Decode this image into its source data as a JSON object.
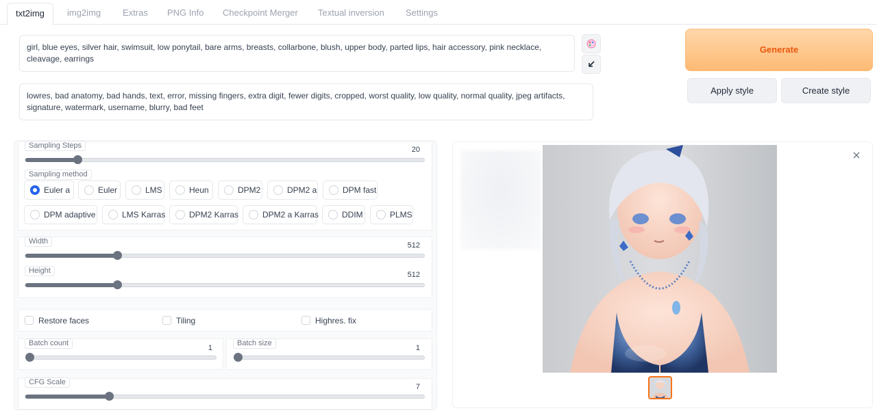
{
  "tabs": [
    "txt2img",
    "img2img",
    "Extras",
    "PNG Info",
    "Checkpoint Merger",
    "Textual inversion",
    "Settings"
  ],
  "prompt": "girl, blue eyes, silver hair, swimsuit, low ponytail, bare arms, breasts, collarbone, blush, upper body, parted lips, hair accessory, pink necklace, cleavage, earrings",
  "negative_prompt": "lowres, bad anatomy, bad hands, text, error, missing fingers, extra digit, fewer digits, cropped, worst quality, low quality, normal quality, jpeg artifacts, signature, watermark, username, blurry, bad feet",
  "icons": {
    "paste": "palette-icon",
    "swap": "arrow-down-left-icon",
    "close": "close-icon"
  },
  "buttons": {
    "generate": "Generate",
    "apply_style": "Apply style",
    "create_style": "Create style"
  },
  "sampling_steps": {
    "label": "Sampling Steps",
    "value": "20",
    "fraction": 0.13
  },
  "sampling_method": {
    "label": "Sampling method",
    "options": [
      "Euler a",
      "Euler",
      "LMS",
      "Heun",
      "DPM2",
      "DPM2 a",
      "DPM fast",
      "DPM adaptive",
      "LMS Karras",
      "DPM2 Karras",
      "DPM2 a Karras",
      "DDIM",
      "PLMS"
    ],
    "selected": "Euler a"
  },
  "width": {
    "label": "Width",
    "value": "512",
    "fraction": 0.23
  },
  "height": {
    "label": "Height",
    "value": "512",
    "fraction": 0.23
  },
  "checkboxes": {
    "restore_faces": "Restore faces",
    "tiling": "Tiling",
    "highres_fix": "Highres. fix"
  },
  "batch_count": {
    "label": "Batch count",
    "value": "1",
    "fraction": 0.0
  },
  "batch_size": {
    "label": "Batch size",
    "value": "1",
    "fraction": 0.0
  },
  "cfg_scale": {
    "label": "CFG Scale",
    "value": "7",
    "fraction": 0.21
  },
  "colors": {
    "accent": "#ea580c",
    "generate_bg": "#fdba74",
    "radio_selected": "#2563eb"
  }
}
